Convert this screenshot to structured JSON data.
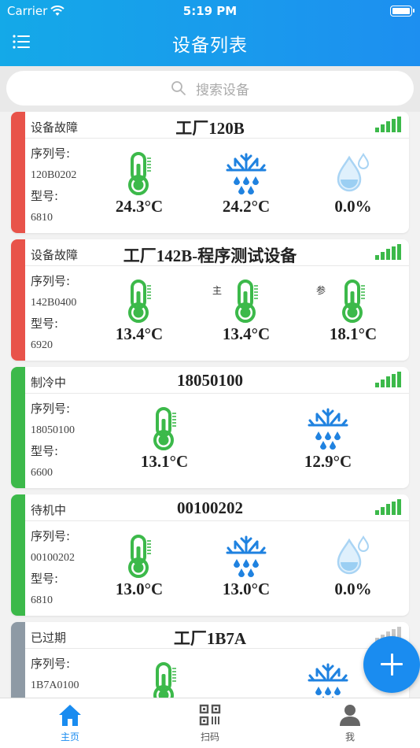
{
  "status_bar": {
    "carrier": "Carrier",
    "time": "5:19 PM"
  },
  "header": {
    "title": "设备列表"
  },
  "search": {
    "placeholder": "搜索设备"
  },
  "labels": {
    "serial": "序列号:",
    "model": "型号:"
  },
  "colors": {
    "fault": "#e8534a",
    "running": "#3cb94a",
    "expired": "#8e9aa5",
    "accent": "#1a8cf0",
    "thermo": "#3cb94a",
    "snow": "#1f82e0"
  },
  "devices": [
    {
      "status": "设备故障",
      "name": "工厂120B",
      "serial": "120B0202",
      "model": "6810",
      "status_type": "fault",
      "signal": "full",
      "sensors": [
        {
          "icon": "thermometer-icon",
          "value": "24.3°C"
        },
        {
          "icon": "snowflake-icon",
          "value": "24.2°C"
        },
        {
          "icon": "humidity-icon",
          "value": "0.0%"
        }
      ]
    },
    {
      "status": "设备故障",
      "name": "工厂142B-程序测试设备",
      "serial": "142B0400",
      "model": "6920",
      "status_type": "fault",
      "signal": "full",
      "sensors": [
        {
          "icon": "thermometer-icon",
          "value": "13.4°C"
        },
        {
          "icon": "thermometer-icon",
          "value": "13.4°C",
          "tag": "主"
        },
        {
          "icon": "thermometer-icon",
          "value": "18.1°C",
          "tag": "参"
        }
      ]
    },
    {
      "status": "制冷中",
      "name": "18050100",
      "serial": "18050100",
      "model": "6600",
      "status_type": "running",
      "signal": "full",
      "sensors": [
        {
          "icon": "thermometer-icon",
          "value": "13.1°C"
        },
        {
          "icon": "snowflake-icon",
          "value": "12.9°C"
        }
      ]
    },
    {
      "status": "待机中",
      "name": "00100202",
      "serial": "00100202",
      "model": "6810",
      "status_type": "running",
      "signal": "full",
      "sensors": [
        {
          "icon": "thermometer-icon",
          "value": "13.0°C"
        },
        {
          "icon": "snowflake-icon",
          "value": "13.0°C"
        },
        {
          "icon": "humidity-icon",
          "value": "0.0%"
        }
      ]
    },
    {
      "status": "已过期",
      "name": "工厂1B7A",
      "serial": "1B7A0100",
      "model": "",
      "status_type": "expired",
      "signal": "none",
      "sensors": [
        {
          "icon": "thermometer-icon",
          "value": ""
        },
        {
          "icon": "snowflake-icon",
          "value": ""
        }
      ]
    }
  ],
  "tabs": [
    {
      "label": "主页",
      "icon": "home-icon",
      "active": true
    },
    {
      "label": "扫码",
      "icon": "qrcode-icon",
      "active": false
    },
    {
      "label": "我",
      "icon": "profile-icon",
      "active": false
    }
  ]
}
